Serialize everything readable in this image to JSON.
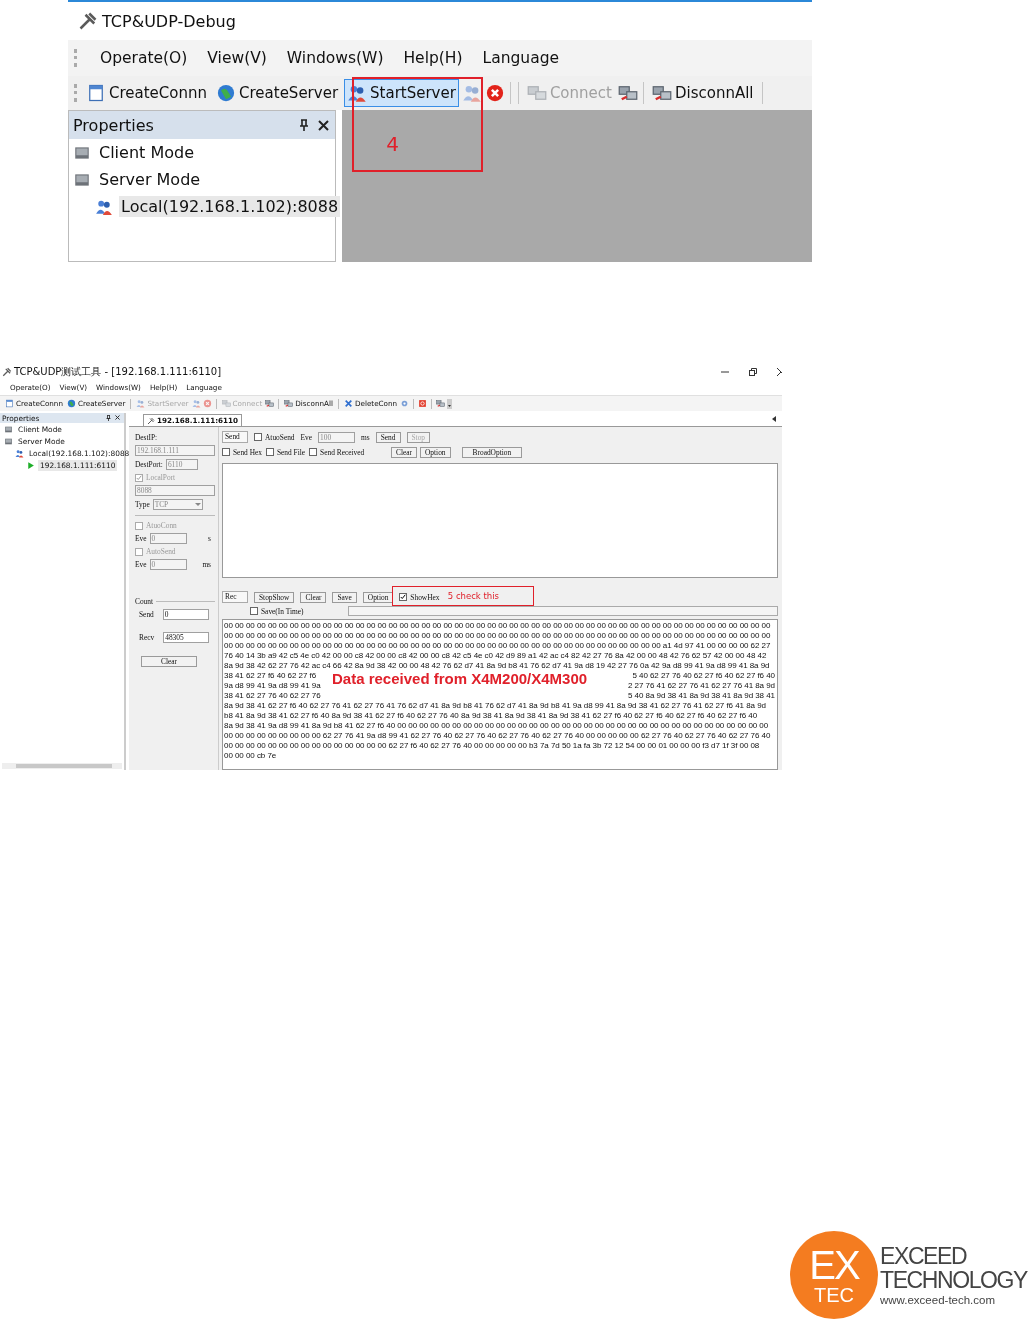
{
  "screenshot_top": {
    "title": "TCP&UDP-Debug",
    "menu": [
      "Operate(O)",
      "View(V)",
      "Windows(W)",
      "Help(H)",
      "Language"
    ],
    "toolbar": [
      {
        "label": "CreateConnn",
        "selected": false,
        "disabled": false
      },
      {
        "label": "CreateServer",
        "selected": false,
        "disabled": false
      },
      {
        "label": "StartServer",
        "selected": true,
        "disabled": false
      },
      {
        "label": "Connect",
        "selected": false,
        "disabled": true
      },
      {
        "label": "DisconnAll",
        "selected": false,
        "disabled": false
      }
    ],
    "callout": "4",
    "properties": {
      "title": "Properties",
      "tree": [
        {
          "label": "Client Mode",
          "selected": false
        },
        {
          "label": "Server Mode",
          "selected": false,
          "children": [
            {
              "label": "Local(192.168.1.102):8088",
              "selected": true
            }
          ]
        }
      ]
    }
  },
  "screenshot_bottom": {
    "title": "TCP&UDP测试工具 - [192.168.1.111:6110]",
    "menu": [
      "Operate(O)",
      "View(V)",
      "Windows(W)",
      "Help(H)",
      "Language"
    ],
    "toolbar": [
      {
        "label": "CreateConnn",
        "disabled": false
      },
      {
        "label": "CreateServer",
        "disabled": false
      },
      {
        "label": "StartServer",
        "disabled": true
      },
      {
        "label": "Connect",
        "disabled": true
      },
      {
        "label": "DisconnAll",
        "disabled": false
      },
      {
        "label": "DeleteConn",
        "disabled": false
      }
    ],
    "properties": {
      "title": "Properties",
      "tree": [
        {
          "label": "Client Mode",
          "selected": false
        },
        {
          "label": "Server Mode",
          "selected": false,
          "children": [
            {
              "label": "Local(192.168.1.102):8088",
              "selected": false,
              "children": [
                {
                  "label": "192.168.1.111:6110",
                  "selected": true
                }
              ]
            }
          ]
        }
      ]
    },
    "tabs": [
      {
        "label": "192.168.1.111:6110",
        "selected": true
      }
    ],
    "settings": {
      "dest_ip_label": "DestIP:",
      "dest_ip": "192.168.1.111",
      "dest_port_label": "DestPort:",
      "dest_port": "6110",
      "local_port": {
        "label": "LocalPort",
        "checked": true,
        "disabled": true
      },
      "local_port_value": "8088",
      "type_label": "Type",
      "type_value": "TCP",
      "auto_conn": {
        "label": "AtuoConn",
        "checked": false,
        "disabled": true
      },
      "auto_conn_eve_label": "Eve",
      "auto_conn_eve": "0",
      "auto_conn_unit": "s",
      "auto_send": {
        "label": "AutoSend",
        "checked": false,
        "disabled": true
      },
      "auto_send_eve_label": "Eve",
      "auto_send_eve": "0",
      "auto_send_unit": "ms",
      "count_label": "Count",
      "send_label": "Send",
      "send_count": "0",
      "recv_label": "Recv",
      "recv_count": "48305",
      "clear_button": "Clear"
    },
    "send_panel": {
      "mode": "Send",
      "auto_send": {
        "label": "AtuoSend",
        "checked": false
      },
      "eve_label": "Eve",
      "eve_value": "100",
      "unit": "ms",
      "buttons": [
        {
          "label": "Send",
          "disabled": false
        },
        {
          "label": "Stop",
          "disabled": true
        }
      ],
      "options": [
        {
          "label": "Send Hex",
          "checked": false
        },
        {
          "label": "Send File",
          "checked": false
        },
        {
          "label": "Send Received",
          "checked": false
        }
      ],
      "buttons_2": [
        "Clear",
        "Option",
        "BroadOption"
      ]
    },
    "receive_panel": {
      "mode": "Rec",
      "buttons": [
        "StopShow",
        "Clear",
        "Save",
        "Option"
      ],
      "show_hex": {
        "label": "ShowHex",
        "checked": true
      },
      "callout": "5 check this",
      "save_in_time": {
        "label": "Save(In Time)",
        "checked": false
      },
      "hex_lines": [
        {
          "kind": "full",
          "text": "00 00 00 00 00 00 00 00 00 00 00 00 00 00 00 00 00 00 00 00 00 00 00 00 00 00 00 00 00 00 00 00 00 00 00 00 00 00 00 00 00 00 00 00 00 00 00 00 00 00"
        },
        {
          "kind": "full",
          "text": "00 00 00 00 00 00 00 00 00 00 00 00 00 00 00 00 00 00 00 00 00 00 00 00 00 00 00 00 00 00 00 00 00 00 00 00 00 00 00 00 00 00 00 00 00 00 00 00 00 00"
        },
        {
          "kind": "full",
          "text": "00 00 00 00 00 00 00 00 00 00 00 00 00 00 00 00 00 00 00 00 00 00 00 00 00 00 00 00 00 00 00 00 00 00 00 00 00 00 00 00 a1 4d 97 41 00 00 00 00 62 27"
        },
        {
          "kind": "full",
          "text": "76 40 14 3b a9 42 c5 4e c0 42 00 00 c8 42 00 00 c8 42 00 00 c8 42 c5 4e c0 42 d9 89 a1 42 ac c4 82 42 27 76 8a 42 00 00 48 42 76 62 57 42 00 00 48 42"
        },
        {
          "kind": "full",
          "text": "8a 9d 38 42 62 27 76 42 ac c4 66 42 8a 9d 38 42 00 00 48 42 76 62 d7 41 8a 9d b8 41 76 62 d7 41 9a d8 19 42 27 76 0a 42 9a d8 99 41 9a d8 99 41 8a 9d"
        },
        {
          "kind": "split",
          "left": "38 41 62 27 f6 40 62 27 f6",
          "right": "5 40 62 27 76 40 62 27 f6 40 62 27 f6 40"
        },
        {
          "kind": "split",
          "left": "9a d8 99 41 9a d8 99 41 9a",
          "right": "2 27 76 41 62 27 76 41 62 27 76 41 8a 9d"
        },
        {
          "kind": "split",
          "left": "38 41 62 27 76 40 62 27 76",
          "right": "5 40 8a 9d 38 41 8a 9d 38 41 8a 9d 38 41"
        },
        {
          "kind": "full",
          "text": "8a 9d 38 41 62 27 f6 40 62 27 76 41 62 27 76 41 76 62 d7 41 8a 9d b8 41 76 62 d7 41 8a 9d b8 41 9a d8 99 41 8a 9d 38 41 62 27 76 41 62 27 f6 41 8a 9d"
        },
        {
          "kind": "full",
          "text": "b8 41 8a 9d 38 41 62 27 f6 40 8a 9d 38 41 62 27 f6 40 62 27 76 40 8a 9d 38 41 8a 9d 38 41 8a 9d 38 41 62 27 f6 40 62 27 f6 40 62 27 f6 40 62 27 f6 40"
        },
        {
          "kind": "full",
          "text": "8a 9d 38 41 9a d8 99 41 8a 9d b8 41 62 27 f6 40 00 00 00 00 00 00 00 00 00 00 00 00 00 00 00 00 00 00 00 00 00 00 00 00 00 00 00 00 00 00 00 00 00 00"
        },
        {
          "kind": "full",
          "text": "00 00 00 00 00 00 00 00 00 62 27 76 41 9a d8 99 41 62 27 76 40 62 27 76 40 62 27 76 40 62 27 76 40 00 00 00 00 00 62 27 76 40 62 27 76 40 62 27 76 40"
        },
        {
          "kind": "full",
          "text": "00 00 00 00 00 00 00 00 00 00 00 00 00 00 00 62 27 f6 40 62 27 76 40 00 00 00 00 00 b3 7a 7d 50 1a fa 3b 72 12 54 00 00 01 00 00 00 f3 d7 1f 3f 00 08"
        },
        {
          "kind": "full",
          "text": "00 00 00 cb 7e"
        }
      ],
      "overlay_note": "Data received from X4M200/X4M300"
    }
  },
  "logo": {
    "mark": [
      "EX",
      "TEC"
    ],
    "name_lines": [
      "EXCEED",
      "TECHNOLOGY"
    ],
    "url": "www.exceed-tech.com"
  }
}
